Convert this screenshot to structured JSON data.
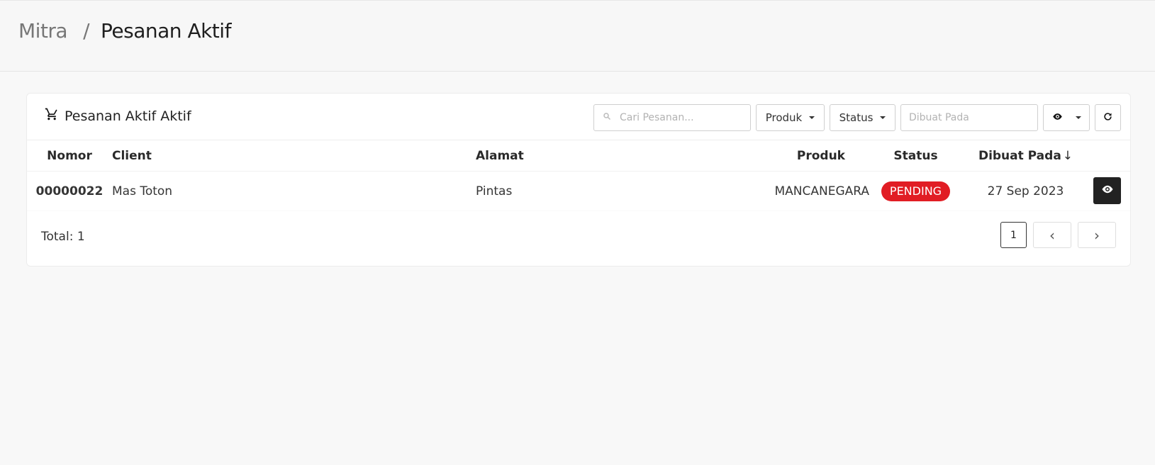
{
  "breadcrumb": {
    "parent": "Mitra",
    "separator": "/",
    "current": "Pesanan Aktif"
  },
  "card": {
    "title": "Pesanan Aktif Aktif",
    "icon": "cart-icon",
    "search_placeholder": "Cari Pesanan...",
    "filters": [
      {
        "label": "Produk"
      },
      {
        "label": "Status"
      }
    ],
    "date_placeholder": "Dibuat Pada"
  },
  "table": {
    "headers": [
      "Nomor",
      "Client",
      "Alamat",
      "Produk",
      "Status",
      "Dibuat Pada"
    ],
    "sort_indicator": "↓",
    "rows": [
      {
        "nomor": "00000022",
        "client": "Mas Toton",
        "alamat": "Pintas",
        "produk": "MANCANEGARA",
        "status": "PENDING",
        "dibuat": "27 Sep 2023"
      }
    ]
  },
  "footer": {
    "total": "Total: 1",
    "page": "1"
  },
  "colors": {
    "badge": "#e11d24",
    "action_bg": "#222222"
  }
}
